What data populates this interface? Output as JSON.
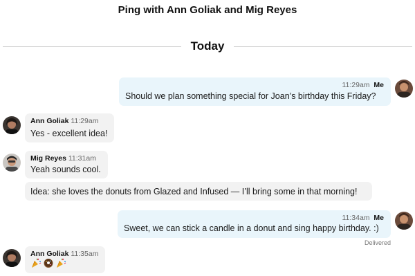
{
  "header": {
    "title": "Ping with Ann Goliak and Mig Reyes"
  },
  "divider": {
    "label": "Today"
  },
  "messages": [
    {
      "author": "Me",
      "time": "11:29am",
      "text": "Should we plan something special for Joan’s birthday this Friday?"
    },
    {
      "author": "Ann Goliak",
      "time": "11:29am",
      "text": "Yes - excellent idea!"
    },
    {
      "author": "Mig Reyes",
      "time": "11:31am",
      "text": "Yeah sounds cool."
    },
    {
      "author": "Mig Reyes",
      "text": "Idea: she loves the donuts from Glazed and Infused — I’ll bring some in that morning!"
    },
    {
      "author": "Me",
      "time": "11:34am",
      "text": "Sweet, we can stick a candle in a donut and sing happy birthday. :)",
      "status": "Delivered"
    },
    {
      "author": "Ann Goliak",
      "time": "11:35am",
      "emoji": [
        "party-popper-icon",
        "donut-icon",
        "party-popper-icon"
      ]
    }
  ],
  "colors": {
    "mine_bubble": "#e9f5fb",
    "theirs_bubble": "#f2f2f2",
    "divider": "#cfcfcf"
  }
}
